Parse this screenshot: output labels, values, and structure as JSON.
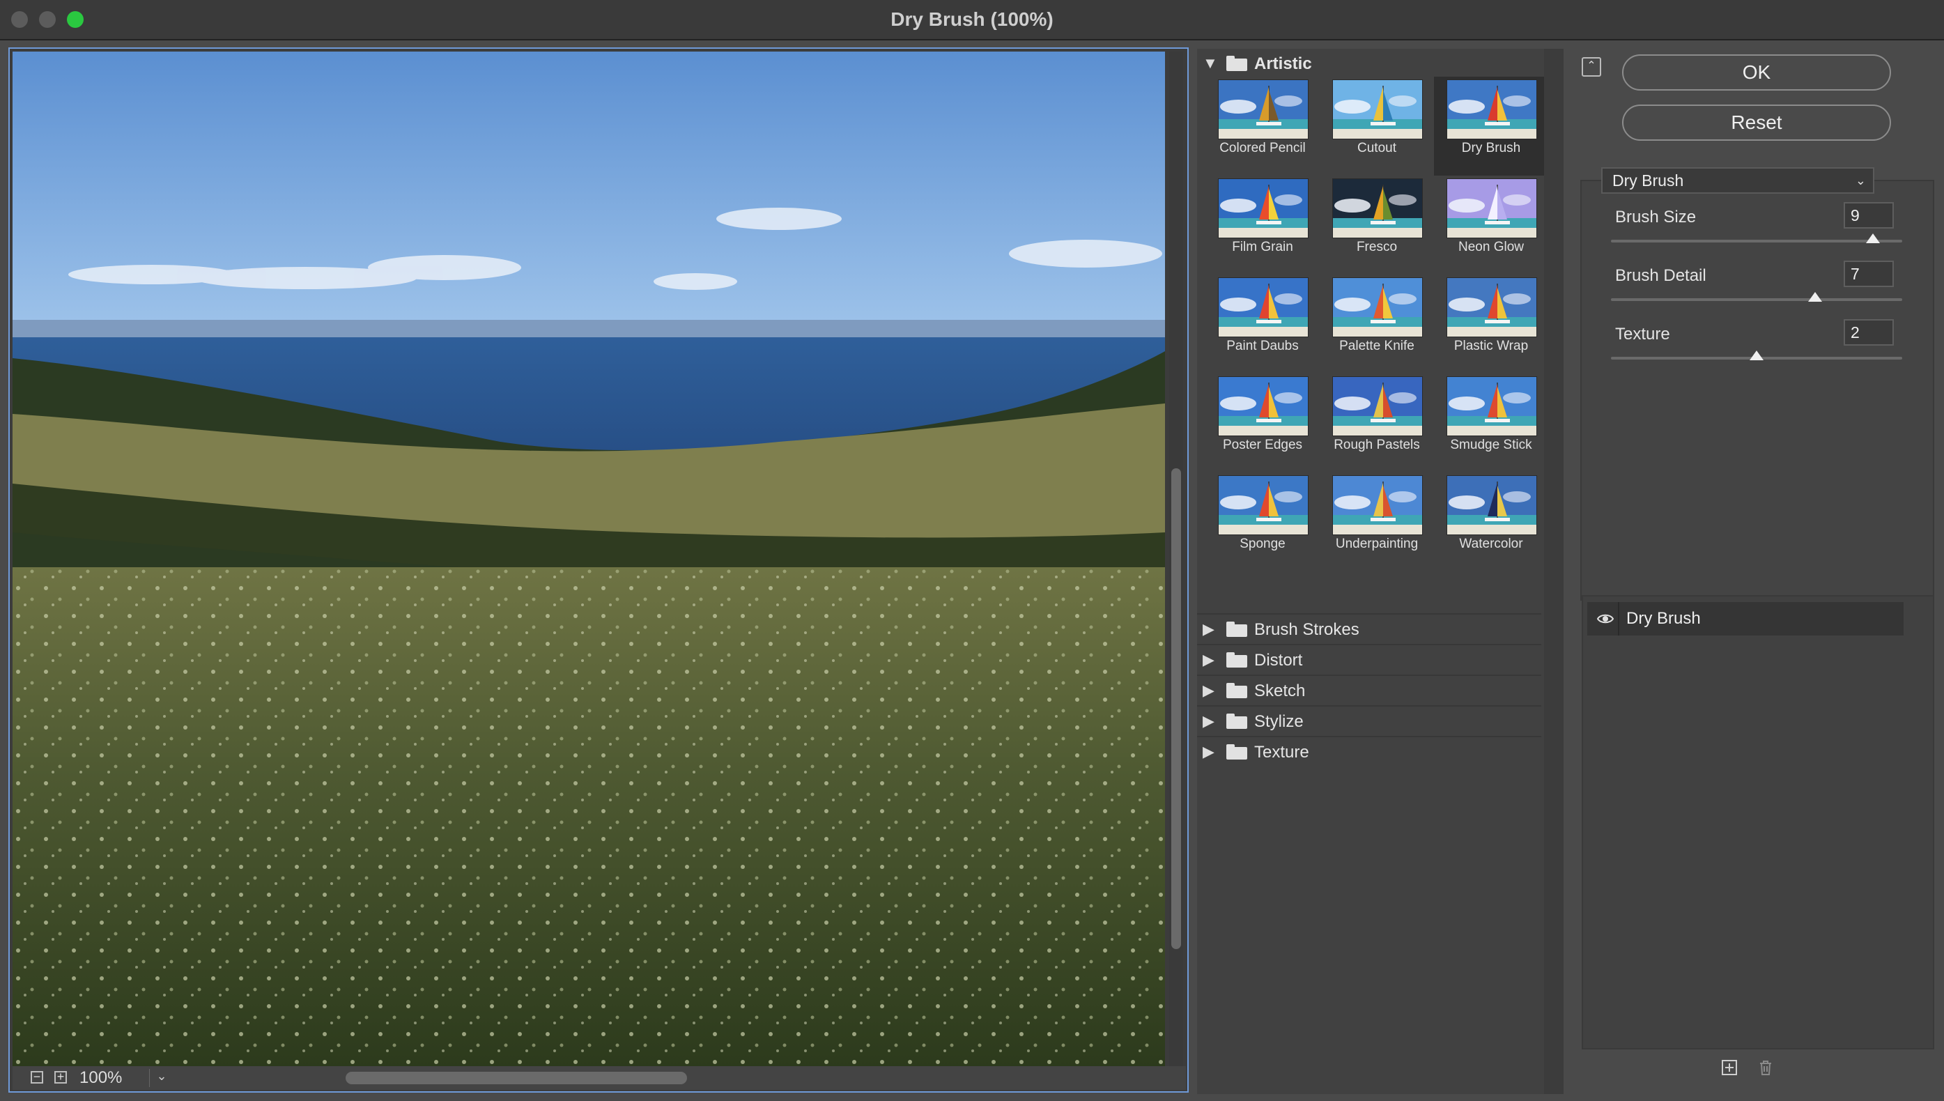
{
  "window": {
    "title": "Dry Brush (100%)"
  },
  "preview": {
    "zoom": "100%",
    "zoom_out": "−",
    "zoom_in": "+",
    "zoom_dropdown": "⌄"
  },
  "gallery": {
    "open_category": "Artistic",
    "filters": [
      {
        "label": "Colored Pencil",
        "sky": "#3b74c2",
        "hue": "pencil"
      },
      {
        "label": "Cutout",
        "sky": "#6fb3e6",
        "hue": "cutout"
      },
      {
        "label": "Dry Brush",
        "sky": "#3f78c5",
        "hue": "dry"
      },
      {
        "label": "Film Grain",
        "sky": "#2f6bc0",
        "hue": "grain"
      },
      {
        "label": "Fresco",
        "sky": "#1c2a3a",
        "hue": "fresco"
      },
      {
        "label": "Neon Glow",
        "sky": "#a79be6",
        "hue": "neon"
      },
      {
        "label": "Paint Daubs",
        "sky": "#3773c8",
        "hue": "daubs"
      },
      {
        "label": "Palette Knife",
        "sky": "#4f8fd8",
        "hue": "knife"
      },
      {
        "label": "Plastic Wrap",
        "sky": "#4478c0",
        "hue": "wrap"
      },
      {
        "label": "Poster Edges",
        "sky": "#3a7ad0",
        "hue": "poster"
      },
      {
        "label": "Rough Pastels",
        "sky": "#3866bf",
        "hue": "pastels"
      },
      {
        "label": "Smudge Stick",
        "sky": "#4383d2",
        "hue": "smudge"
      },
      {
        "label": "Sponge",
        "sky": "#3c78c6",
        "hue": "sponge"
      },
      {
        "label": "Underpainting",
        "sky": "#4d88d4",
        "hue": "under"
      },
      {
        "label": "Watercolor",
        "sky": "#3d6fb8",
        "hue": "water"
      }
    ],
    "closed_categories": [
      "Brush Strokes",
      "Distort",
      "Sketch",
      "Stylize",
      "Texture"
    ]
  },
  "actions": {
    "ok_label": "OK",
    "reset_label": "Reset",
    "collapse_glyph": "⌃"
  },
  "settings": {
    "filter_name": "Dry Brush",
    "params": [
      {
        "label": "Brush Size",
        "value": "9",
        "level": 0.9
      },
      {
        "label": "Brush Detail",
        "value": "7",
        "level": 0.7
      },
      {
        "label": "Texture",
        "value": "2",
        "level": 0.5
      }
    ]
  },
  "layers": {
    "items": [
      {
        "label": "Dry Brush"
      }
    ]
  },
  "colors": {
    "accent": "#6f9ad8",
    "traffic_green": "#2ac840"
  }
}
